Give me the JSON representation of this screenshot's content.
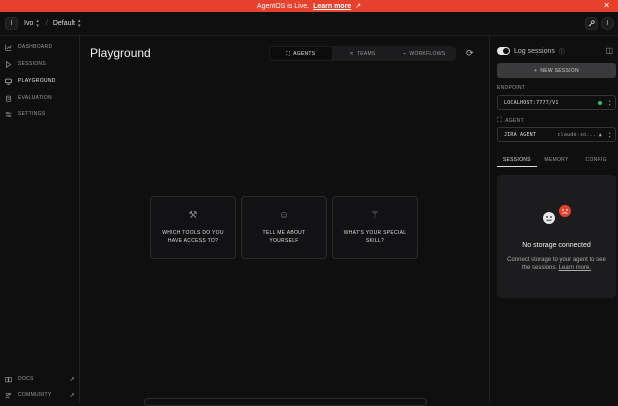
{
  "banner": {
    "text": "AgentOS is Live.",
    "link": "Learn more"
  },
  "topbar": {
    "org_initial": "I",
    "org_name": "Ivo",
    "separator": "/",
    "project": "Default",
    "user_initial": "I"
  },
  "sidebar": {
    "items": [
      {
        "label": "DASHBOARD"
      },
      {
        "label": "SESSIONS"
      },
      {
        "label": "PLAYGROUND"
      },
      {
        "label": "EVALUATION"
      },
      {
        "label": "SETTINGS"
      }
    ],
    "footer": [
      {
        "label": "DOCS"
      },
      {
        "label": "COMMUNITY"
      }
    ]
  },
  "main": {
    "title": "Playground",
    "tabs": [
      {
        "label": "AGENTS"
      },
      {
        "label": "TEAMS"
      },
      {
        "label": "WORKFLOWS"
      }
    ],
    "suggestions": [
      {
        "line1": "WHICH TOOLS DO YOU",
        "line2": "HAVE ACCESS TO?"
      },
      {
        "line1": "TELL ME ABOUT",
        "line2": "YOURSELF"
      },
      {
        "line1": "WHAT'S YOUR SPECIAL",
        "line2": "SKILL?"
      }
    ]
  },
  "panel": {
    "log_sessions": "Log sessions",
    "new_session": "NEW SESSION",
    "endpoint_label": "ENDPOINT",
    "endpoint_value": "LOCALHOST:7777/V1",
    "agent_label": "AGENT",
    "agent_name": "JIRA AGENT",
    "agent_model": "claude-so...",
    "tabs": [
      {
        "label": "SESSIONS"
      },
      {
        "label": "MEMORY"
      },
      {
        "label": "CONFIG"
      }
    ],
    "empty_title": "No storage connected",
    "empty_desc": "Connect storage to your agent to see the sessions.",
    "empty_link": "Learn more."
  }
}
